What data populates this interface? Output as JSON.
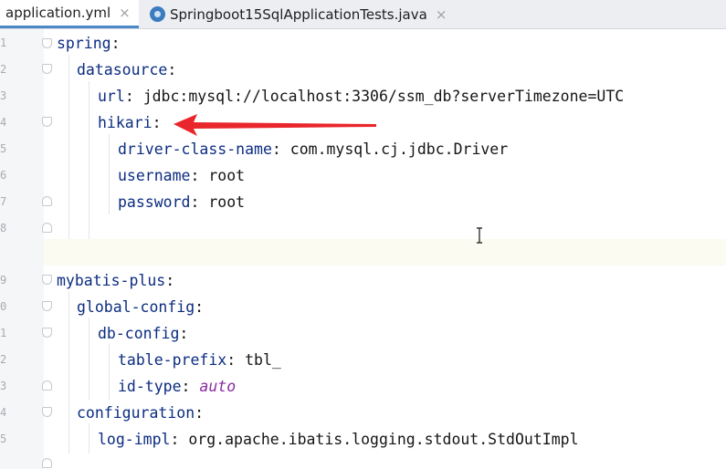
{
  "tabs": [
    {
      "label": "application.yml",
      "close": "×",
      "active": true
    },
    {
      "label": "Springboot15SqlApplicationTests.java",
      "close": "×",
      "active": false
    }
  ],
  "gutter": {
    "line_numbers": [
      "1",
      "2",
      "3",
      "4",
      "5",
      "6",
      "7",
      "8",
      "9",
      "0",
      "1",
      "2",
      "3",
      "4",
      "5"
    ]
  },
  "code": {
    "l1": {
      "key": "spring",
      "sep": ":"
    },
    "l2": {
      "key": "datasource",
      "sep": ":"
    },
    "l3": {
      "key": "url",
      "sep": ": ",
      "value": "jdbc:mysql://localhost:3306/ssm_db?serverTimezone=UTC"
    },
    "l4": {
      "key": "hikari",
      "sep": ":"
    },
    "l5": {
      "key": "driver-class-name",
      "sep": ": ",
      "value": "com.mysql.cj.jdbc.Driver"
    },
    "l6": {
      "key": "username",
      "sep": ": ",
      "value": "root"
    },
    "l7": {
      "key": "password",
      "sep": ": ",
      "value": "root"
    },
    "l9": {
      "key": "mybatis-plus",
      "sep": ":"
    },
    "l10": {
      "key": "global-config",
      "sep": ":"
    },
    "l11": {
      "key": "db-config",
      "sep": ":"
    },
    "l12": {
      "key": "table-prefix",
      "sep": ": ",
      "value": "tbl_"
    },
    "l13": {
      "key": "id-type",
      "sep": ": ",
      "value": "auto"
    },
    "l14": {
      "key": "configuration",
      "sep": ":"
    },
    "l15": {
      "key": "log-impl",
      "sep": ": ",
      "value": "org.apache.ibatis.logging.stdout.StdOutImpl"
    }
  },
  "colors": {
    "key": "#0b2c80",
    "value": "#151515",
    "keyword_value": "#8a2aa0",
    "annotation_arrow": "#e8262b",
    "tab_underline": "#4a88c7"
  },
  "icons": [
    "yaml-file-icon",
    "spring-test-file-icon",
    "close-icon",
    "fold-icon",
    "text-cursor-icon",
    "annotation-arrow"
  ]
}
